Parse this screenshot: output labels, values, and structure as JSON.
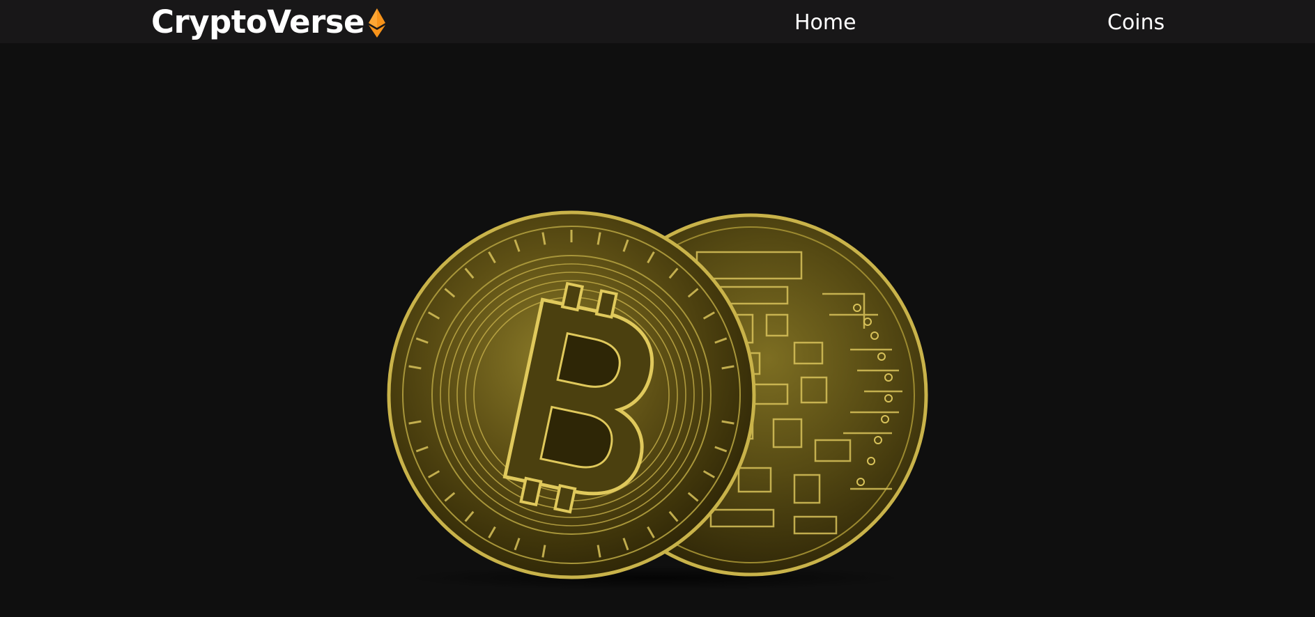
{
  "navbar": {
    "brand": "CryptoVerse",
    "brand_icon": "ethereum-icon",
    "links": [
      {
        "label": "Home"
      },
      {
        "label": "Coins"
      }
    ]
  },
  "hero": {
    "image": "bitcoin-coins-image"
  },
  "colors": {
    "background": "#0f0f0f",
    "navbar": "#181718",
    "accent": "#f7931a",
    "text": "#ffffff",
    "gold": "#b8a23a"
  }
}
